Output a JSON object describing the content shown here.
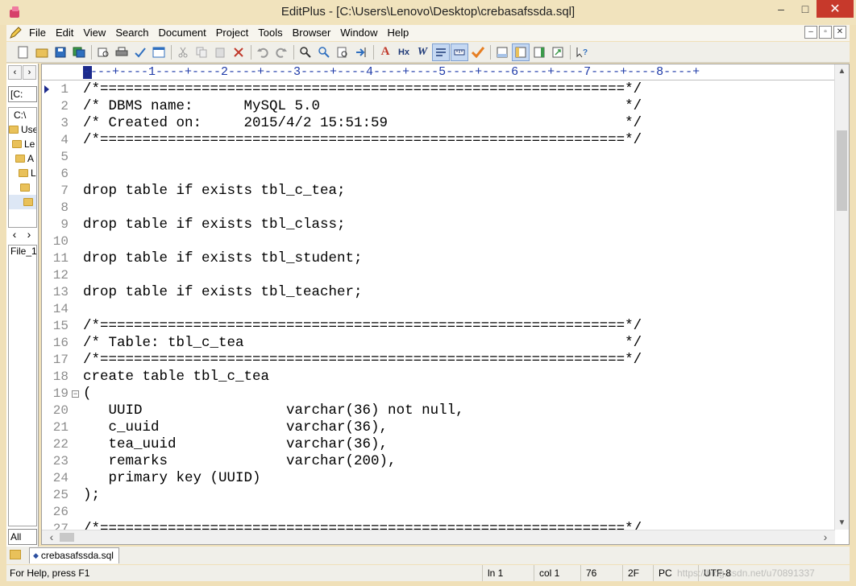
{
  "window": {
    "title": "EditPlus - [C:\\Users\\Lenovo\\Desktop\\crebasafssda.sql]",
    "minimize": "–",
    "maximize": "□",
    "close": "✕"
  },
  "menu": [
    "File",
    "Edit",
    "View",
    "Search",
    "Document",
    "Project",
    "Tools",
    "Browser",
    "Window",
    "Help"
  ],
  "mdi_buttons": [
    "–",
    "▫",
    "✕"
  ],
  "toolbar": {
    "icons": [
      "new-file-icon",
      "open-folder-icon",
      "save-icon",
      "save-all-icon",
      "print-preview-icon",
      "print-icon",
      "spellcheck-icon",
      "browser-preview-icon",
      "cut-icon",
      "copy-icon",
      "paste-icon",
      "delete-icon",
      "undo-icon",
      "redo-icon",
      "find-icon",
      "replace-icon",
      "find-in-files-icon",
      "goto-icon",
      "font-icon",
      "hex-icon",
      "italic-w-icon",
      "word-wrap-icon",
      "ruler-icon",
      "check-icon",
      "toggle-output-icon",
      "directory-icon",
      "cliptext-icon",
      "fullscreen-icon",
      "help-context-icon"
    ],
    "labels": {
      "font": "A",
      "hex": "Hx",
      "wrap": "W"
    }
  },
  "left_panel": {
    "nav_prev": "‹",
    "nav_next": "›",
    "drive": "[C:",
    "tree": [
      "C:\\",
      "Use",
      "Le",
      "A",
      "L",
      "",
      ""
    ],
    "scroll_left": "‹",
    "scroll_right": "›",
    "file": "File_1",
    "filter": "All"
  },
  "ruler": "----+----1----+----2----+----3----+----4----+----5----+----6----+----7----+----8----+",
  "lines": [
    {
      "n": "1",
      "text": "/*==============================================================*/"
    },
    {
      "n": "2",
      "text": "/* DBMS name:      MySQL 5.0                                    */"
    },
    {
      "n": "3",
      "text": "/* Created on:     2015/4/2 15:51:59                            */"
    },
    {
      "n": "4",
      "text": "/*==============================================================*/"
    },
    {
      "n": "5",
      "text": ""
    },
    {
      "n": "6",
      "text": ""
    },
    {
      "n": "7",
      "text": "drop table if exists tbl_c_tea;"
    },
    {
      "n": "8",
      "text": ""
    },
    {
      "n": "9",
      "text": "drop table if exists tbl_class;"
    },
    {
      "n": "10",
      "text": ""
    },
    {
      "n": "11",
      "text": "drop table if exists tbl_student;"
    },
    {
      "n": "12",
      "text": ""
    },
    {
      "n": "13",
      "text": "drop table if exists tbl_teacher;"
    },
    {
      "n": "14",
      "text": ""
    },
    {
      "n": "15",
      "text": "/*==============================================================*/"
    },
    {
      "n": "16",
      "text": "/* Table: tbl_c_tea                                             */"
    },
    {
      "n": "17",
      "text": "/*==============================================================*/"
    },
    {
      "n": "18",
      "text": "create table tbl_c_tea"
    },
    {
      "n": "19",
      "text": "("
    },
    {
      "n": "20",
      "text": "   UUID                 varchar(36) not null,"
    },
    {
      "n": "21",
      "text": "   c_uuid               varchar(36),"
    },
    {
      "n": "22",
      "text": "   tea_uuid             varchar(36),"
    },
    {
      "n": "23",
      "text": "   remarks              varchar(200),"
    },
    {
      "n": "24",
      "text": "   primary key (UUID)"
    },
    {
      "n": "25",
      "text": ");"
    },
    {
      "n": "26",
      "text": ""
    },
    {
      "n": "27",
      "text": "/*==============================================================*/"
    }
  ],
  "fold_marker": "−",
  "doc_tab": {
    "label": "crebasafssda.sql"
  },
  "status": {
    "help": "For Help, press F1",
    "ln": "ln 1",
    "col": "col 1",
    "count": "76",
    "hex": "2F",
    "mode": "PC",
    "encoding": "UTF-8"
  },
  "watermark": "https://blog.csdn.net/u70891337"
}
